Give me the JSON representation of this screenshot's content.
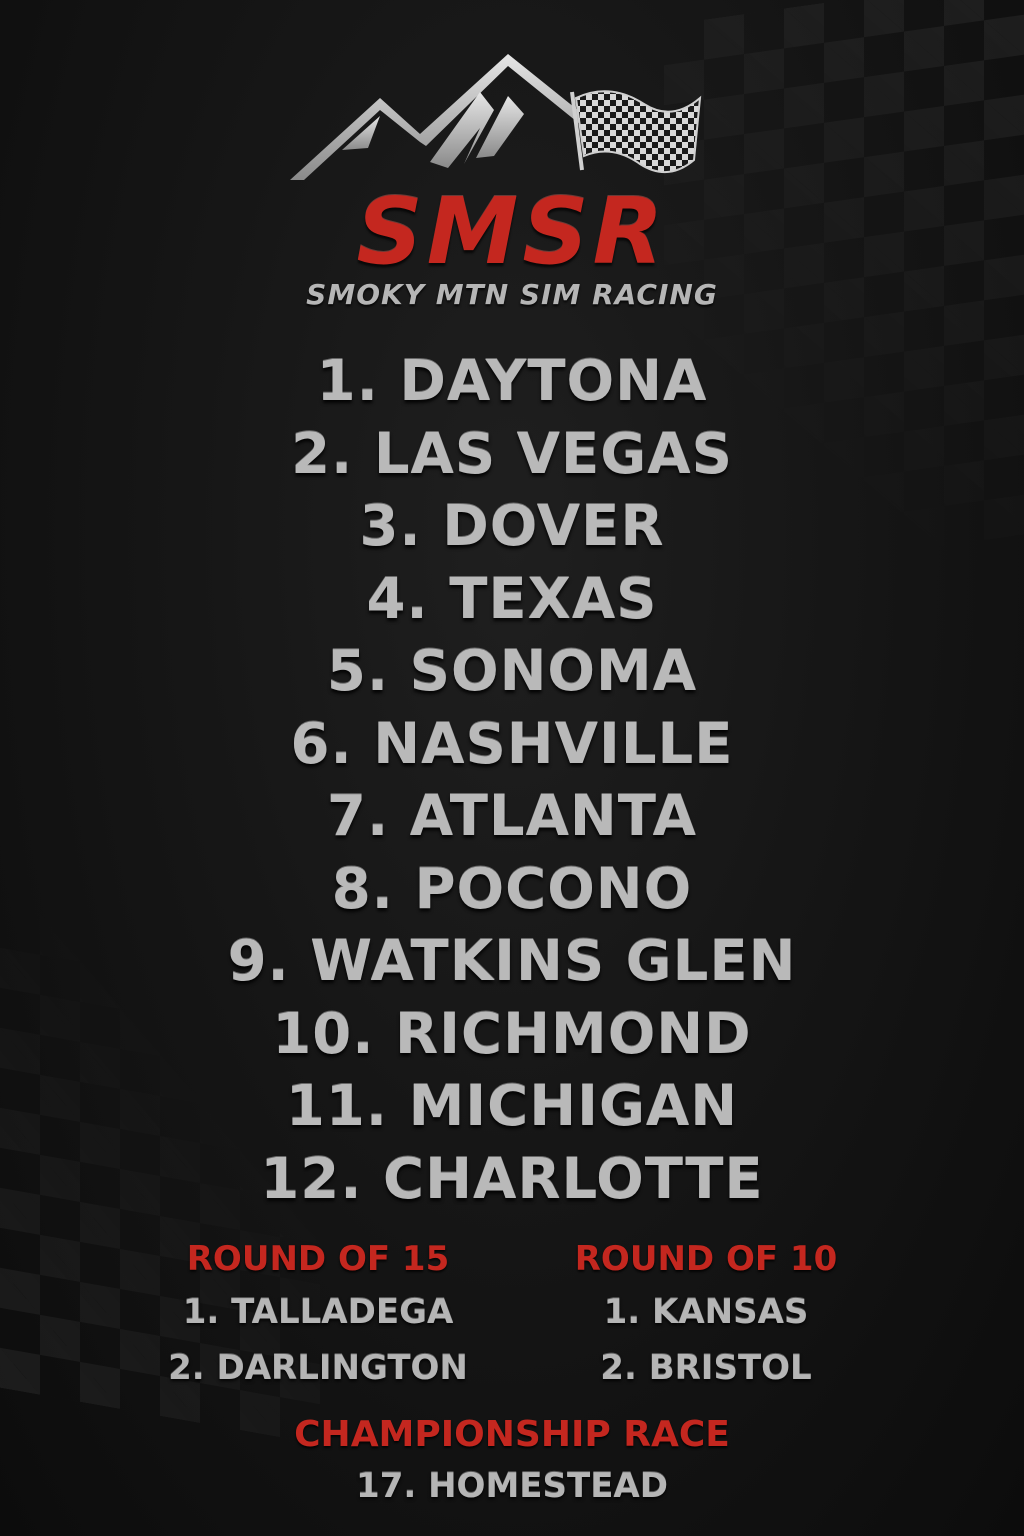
{
  "logo": {
    "brand": "SMSR",
    "tagline": "SMOKY MTN SIM RACING",
    "emblem_icon": "mountain-checkered-flag-icon"
  },
  "races": [
    "1. DAYTONA",
    "2. LAS VEGAS",
    "3. DOVER",
    "4. TEXAS",
    "5. SONOMA",
    "6. NASHVILLE",
    "7. ATLANTA",
    "8. POCONO",
    "9. WATKINS GLEN",
    "10. RICHMOND",
    "11. MICHIGAN",
    "12. CHARLOTTE"
  ],
  "round_of_15": {
    "heading": "ROUND OF 15",
    "items": [
      "1. TALLADEGA",
      "2. DARLINGTON"
    ]
  },
  "round_of_10": {
    "heading": "ROUND OF 10",
    "items": [
      "1. KANSAS",
      "2. BRISTOL"
    ]
  },
  "championship": {
    "heading": "CHAMPIONSHIP RACE",
    "item": "17. HOMESTEAD"
  },
  "colors": {
    "accent_red": "#c4271f",
    "silver_text": "#b9b9b9",
    "background": "#121212"
  }
}
